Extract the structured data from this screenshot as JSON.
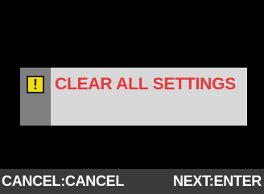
{
  "dialog": {
    "icon": "warning-icon",
    "icon_glyph": "!",
    "title": "CLEAR ALL SETTINGS",
    "colors": {
      "title": "#e8373a",
      "icon_bg": "#f5e10a",
      "panel_bg": "#d8d8d8",
      "side_bg": "#808080"
    }
  },
  "footer": {
    "left_hint": "CANCEL:CANCEL",
    "right_hint": "NEXT:ENTER",
    "colors": {
      "bg": "#3a3a3a",
      "text": "#ffffff"
    }
  }
}
